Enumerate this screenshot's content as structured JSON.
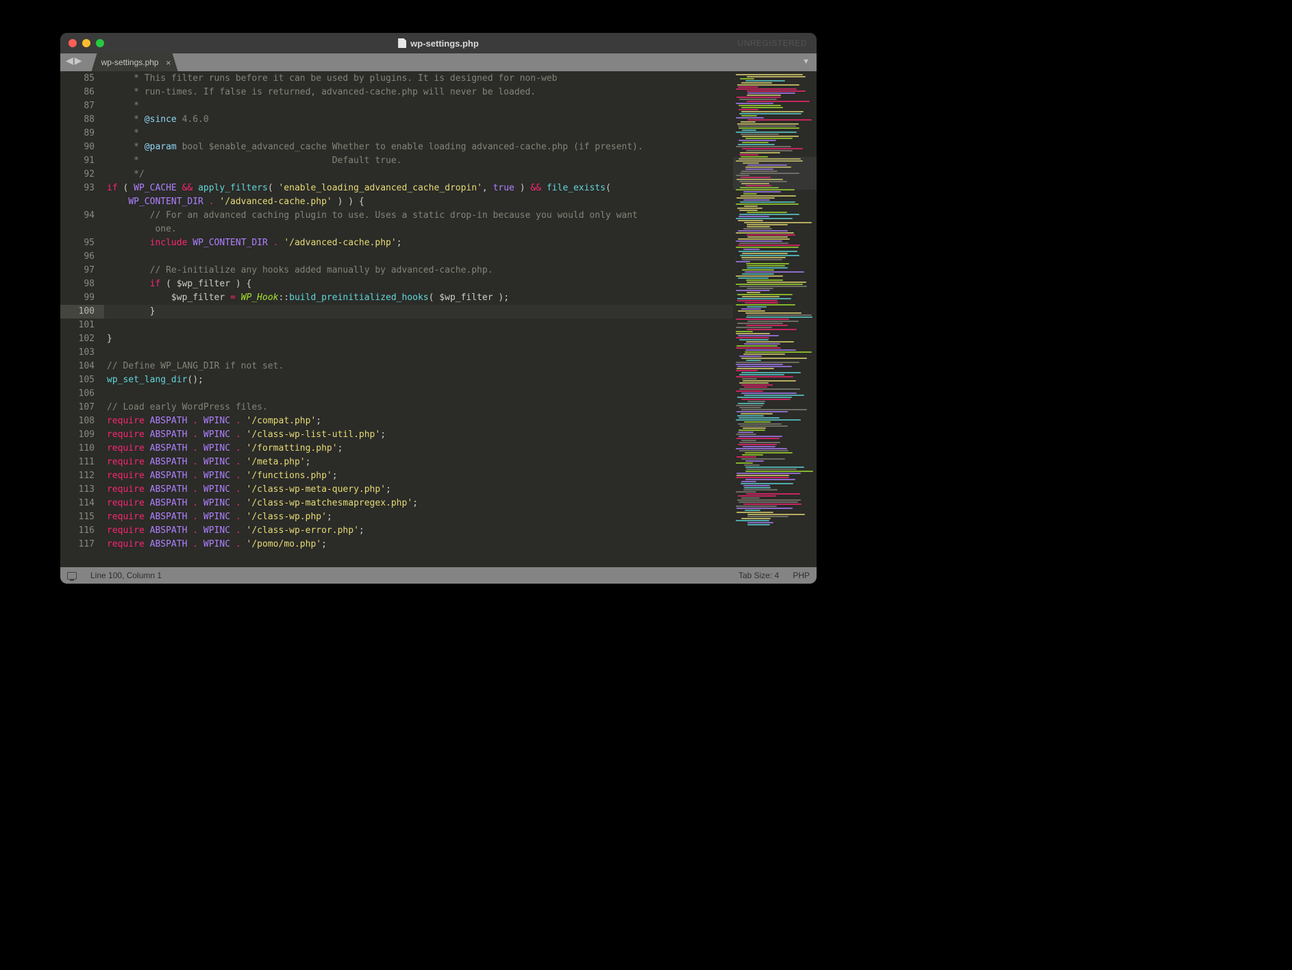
{
  "window": {
    "title": "wp-settings.php",
    "unregistered_label": "UNREGISTERED"
  },
  "tabs": [
    {
      "label": "wp-settings.php"
    }
  ],
  "status": {
    "cursor": "Line 100, Column 1",
    "tab_size": "Tab Size: 4",
    "language": "PHP"
  },
  "gutter": {
    "start": 85,
    "end": 117,
    "highlighted": 100
  },
  "code": {
    "lines": [
      {
        "n": 85,
        "indent": 1,
        "tokens": [
          {
            "t": " * This filter runs before it can be used by plugins. It is designed for non-web",
            "c": "c"
          }
        ]
      },
      {
        "n": 86,
        "indent": 1,
        "tokens": [
          {
            "t": " * run-times. If false is returned, advanced-cache.php will never be loaded.",
            "c": "c"
          }
        ]
      },
      {
        "n": 87,
        "indent": 1,
        "tokens": [
          {
            "t": " *",
            "c": "c"
          }
        ]
      },
      {
        "n": 88,
        "indent": 1,
        "tokens": [
          {
            "t": " * ",
            "c": "c"
          },
          {
            "t": "@since",
            "c": "tag"
          },
          {
            "t": " 4.6.0",
            "c": "c"
          }
        ]
      },
      {
        "n": 89,
        "indent": 1,
        "tokens": [
          {
            "t": " *",
            "c": "c"
          }
        ]
      },
      {
        "n": 90,
        "indent": 1,
        "tokens": [
          {
            "t": " * ",
            "c": "c"
          },
          {
            "t": "@param",
            "c": "tag"
          },
          {
            "t": " bool $enable_advanced_cache Whether to enable loading advanced-cache.php (if present).",
            "c": "c"
          }
        ]
      },
      {
        "n": 91,
        "indent": 1,
        "tokens": [
          {
            "t": " *                                    Default true.",
            "c": "c"
          }
        ]
      },
      {
        "n": 92,
        "indent": 1,
        "tokens": [
          {
            "t": " */",
            "c": "c"
          }
        ]
      },
      {
        "n": 93,
        "indent": 0,
        "wrap": true,
        "tokens": [
          {
            "t": "if",
            "c": "kw"
          },
          {
            "t": " ( "
          },
          {
            "t": "WP_CACHE",
            "c": "cn"
          },
          {
            "t": " "
          },
          {
            "t": "&&",
            "c": "op"
          },
          {
            "t": " "
          },
          {
            "t": "apply_filters",
            "c": "fn"
          },
          {
            "t": "( "
          },
          {
            "t": "'enable_loading_advanced_cache_dropin'",
            "c": "st"
          },
          {
            "t": ", "
          },
          {
            "t": "true",
            "c": "bool"
          },
          {
            "t": " ) "
          },
          {
            "t": "&&",
            "c": "op"
          },
          {
            "t": " "
          },
          {
            "t": "file_exists",
            "c": "fn"
          },
          {
            "t": "( "
          }
        ],
        "wrap_tokens": [
          {
            "t": "WP_CONTENT_DIR",
            "c": "cn"
          },
          {
            "t": " "
          },
          {
            "t": ".",
            "c": "op"
          },
          {
            "t": " "
          },
          {
            "t": "'/advanced-cache.php'",
            "c": "st"
          },
          {
            "t": " ) ) {"
          }
        ]
      },
      {
        "n": 94,
        "indent": 1,
        "wrap": true,
        "tokens": [
          {
            "t": "    "
          },
          {
            "t": "// For an advanced caching plugin to use. Uses a static drop-in because you would only want",
            "c": "c"
          }
        ],
        "wrap_tokens": [
          {
            "t": " one.",
            "c": "c"
          }
        ]
      },
      {
        "n": 95,
        "indent": 1,
        "tokens": [
          {
            "t": "    "
          },
          {
            "t": "include",
            "c": "kw"
          },
          {
            "t": " "
          },
          {
            "t": "WP_CONTENT_DIR",
            "c": "cn"
          },
          {
            "t": " "
          },
          {
            "t": ".",
            "c": "op"
          },
          {
            "t": " "
          },
          {
            "t": "'/advanced-cache.php'",
            "c": "st"
          },
          {
            "t": ";"
          }
        ]
      },
      {
        "n": 96,
        "indent": 0,
        "tokens": []
      },
      {
        "n": 97,
        "indent": 1,
        "tokens": [
          {
            "t": "    "
          },
          {
            "t": "// Re-initialize any hooks added manually by advanced-cache.php.",
            "c": "c"
          }
        ]
      },
      {
        "n": 98,
        "indent": 1,
        "tokens": [
          {
            "t": "    "
          },
          {
            "t": "if",
            "c": "kw"
          },
          {
            "t": " ( $wp_filter ) {"
          }
        ]
      },
      {
        "n": 99,
        "indent": 1,
        "tokens": [
          {
            "t": "        $wp_filter "
          },
          {
            "t": "=",
            "c": "op"
          },
          {
            "t": " "
          },
          {
            "t": "WP_Hook",
            "c": "cl"
          },
          {
            "t": "::"
          },
          {
            "t": "build_preinitialized_hooks",
            "c": "fn"
          },
          {
            "t": "( $wp_filter );"
          }
        ]
      },
      {
        "n": 100,
        "indent": 1,
        "hl": true,
        "tokens": [
          {
            "t": "    }"
          }
        ]
      },
      {
        "n": 101,
        "indent": 0,
        "tokens": [
          {
            "t": "}"
          }
        ]
      },
      {
        "n": 102,
        "indent": 0,
        "tokens": []
      },
      {
        "n": 103,
        "indent": 0,
        "tokens": [
          {
            "t": "// Define WP_LANG_DIR if not set.",
            "c": "c"
          }
        ]
      },
      {
        "n": 104,
        "indent": 0,
        "tokens": [
          {
            "t": "wp_set_lang_dir",
            "c": "fn"
          },
          {
            "t": "();"
          }
        ]
      },
      {
        "n": 105,
        "indent": 0,
        "tokens": []
      },
      {
        "n": 106,
        "indent": 0,
        "tokens": [
          {
            "t": "// Load early WordPress files.",
            "c": "c"
          }
        ]
      },
      {
        "n": 107,
        "indent": 0,
        "tokens": [
          {
            "t": "require",
            "c": "kw"
          },
          {
            "t": " "
          },
          {
            "t": "ABSPATH",
            "c": "cn"
          },
          {
            "t": " "
          },
          {
            "t": ".",
            "c": "op"
          },
          {
            "t": " "
          },
          {
            "t": "WPINC",
            "c": "cn"
          },
          {
            "t": " "
          },
          {
            "t": ".",
            "c": "op"
          },
          {
            "t": " "
          },
          {
            "t": "'/compat.php'",
            "c": "st"
          },
          {
            "t": ";"
          }
        ]
      },
      {
        "n": 108,
        "indent": 0,
        "tokens": [
          {
            "t": "require",
            "c": "kw"
          },
          {
            "t": " "
          },
          {
            "t": "ABSPATH",
            "c": "cn"
          },
          {
            "t": " "
          },
          {
            "t": ".",
            "c": "op"
          },
          {
            "t": " "
          },
          {
            "t": "WPINC",
            "c": "cn"
          },
          {
            "t": " "
          },
          {
            "t": ".",
            "c": "op"
          },
          {
            "t": " "
          },
          {
            "t": "'/class-wp-list-util.php'",
            "c": "st"
          },
          {
            "t": ";"
          }
        ]
      },
      {
        "n": 109,
        "indent": 0,
        "tokens": [
          {
            "t": "require",
            "c": "kw"
          },
          {
            "t": " "
          },
          {
            "t": "ABSPATH",
            "c": "cn"
          },
          {
            "t": " "
          },
          {
            "t": ".",
            "c": "op"
          },
          {
            "t": " "
          },
          {
            "t": "WPINC",
            "c": "cn"
          },
          {
            "t": " "
          },
          {
            "t": ".",
            "c": "op"
          },
          {
            "t": " "
          },
          {
            "t": "'/formatting.php'",
            "c": "st"
          },
          {
            "t": ";"
          }
        ]
      },
      {
        "n": 110,
        "indent": 0,
        "tokens": [
          {
            "t": "require",
            "c": "kw"
          },
          {
            "t": " "
          },
          {
            "t": "ABSPATH",
            "c": "cn"
          },
          {
            "t": " "
          },
          {
            "t": ".",
            "c": "op"
          },
          {
            "t": " "
          },
          {
            "t": "WPINC",
            "c": "cn"
          },
          {
            "t": " "
          },
          {
            "t": ".",
            "c": "op"
          },
          {
            "t": " "
          },
          {
            "t": "'/meta.php'",
            "c": "st"
          },
          {
            "t": ";"
          }
        ]
      },
      {
        "n": 111,
        "indent": 0,
        "tokens": [
          {
            "t": "require",
            "c": "kw"
          },
          {
            "t": " "
          },
          {
            "t": "ABSPATH",
            "c": "cn"
          },
          {
            "t": " "
          },
          {
            "t": ".",
            "c": "op"
          },
          {
            "t": " "
          },
          {
            "t": "WPINC",
            "c": "cn"
          },
          {
            "t": " "
          },
          {
            "t": ".",
            "c": "op"
          },
          {
            "t": " "
          },
          {
            "t": "'/functions.php'",
            "c": "st"
          },
          {
            "t": ";"
          }
        ]
      },
      {
        "n": 112,
        "indent": 0,
        "tokens": [
          {
            "t": "require",
            "c": "kw"
          },
          {
            "t": " "
          },
          {
            "t": "ABSPATH",
            "c": "cn"
          },
          {
            "t": " "
          },
          {
            "t": ".",
            "c": "op"
          },
          {
            "t": " "
          },
          {
            "t": "WPINC",
            "c": "cn"
          },
          {
            "t": " "
          },
          {
            "t": ".",
            "c": "op"
          },
          {
            "t": " "
          },
          {
            "t": "'/class-wp-meta-query.php'",
            "c": "st"
          },
          {
            "t": ";"
          }
        ]
      },
      {
        "n": 113,
        "indent": 0,
        "tokens": [
          {
            "t": "require",
            "c": "kw"
          },
          {
            "t": " "
          },
          {
            "t": "ABSPATH",
            "c": "cn"
          },
          {
            "t": " "
          },
          {
            "t": ".",
            "c": "op"
          },
          {
            "t": " "
          },
          {
            "t": "WPINC",
            "c": "cn"
          },
          {
            "t": " "
          },
          {
            "t": ".",
            "c": "op"
          },
          {
            "t": " "
          },
          {
            "t": "'/class-wp-matchesmapregex.php'",
            "c": "st"
          },
          {
            "t": ";"
          }
        ]
      },
      {
        "n": 114,
        "indent": 0,
        "tokens": [
          {
            "t": "require",
            "c": "kw"
          },
          {
            "t": " "
          },
          {
            "t": "ABSPATH",
            "c": "cn"
          },
          {
            "t": " "
          },
          {
            "t": ".",
            "c": "op"
          },
          {
            "t": " "
          },
          {
            "t": "WPINC",
            "c": "cn"
          },
          {
            "t": " "
          },
          {
            "t": ".",
            "c": "op"
          },
          {
            "t": " "
          },
          {
            "t": "'/class-wp.php'",
            "c": "st"
          },
          {
            "t": ";"
          }
        ]
      },
      {
        "n": 115,
        "indent": 0,
        "tokens": [
          {
            "t": "require",
            "c": "kw"
          },
          {
            "t": " "
          },
          {
            "t": "ABSPATH",
            "c": "cn"
          },
          {
            "t": " "
          },
          {
            "t": ".",
            "c": "op"
          },
          {
            "t": " "
          },
          {
            "t": "WPINC",
            "c": "cn"
          },
          {
            "t": " "
          },
          {
            "t": ".",
            "c": "op"
          },
          {
            "t": " "
          },
          {
            "t": "'/class-wp-error.php'",
            "c": "st"
          },
          {
            "t": ";"
          }
        ]
      },
      {
        "n": 116,
        "indent": 0,
        "tokens": [
          {
            "t": "require",
            "c": "kw"
          },
          {
            "t": " "
          },
          {
            "t": "ABSPATH",
            "c": "cn"
          },
          {
            "t": " "
          },
          {
            "t": ".",
            "c": "op"
          },
          {
            "t": " "
          },
          {
            "t": "WPINC",
            "c": "cn"
          },
          {
            "t": " "
          },
          {
            "t": ".",
            "c": "op"
          },
          {
            "t": " "
          },
          {
            "t": "'/pomo/mo.php'",
            "c": "st"
          },
          {
            "t": ";"
          }
        ]
      },
      {
        "n": 117,
        "indent": 0,
        "tokens": []
      }
    ]
  }
}
